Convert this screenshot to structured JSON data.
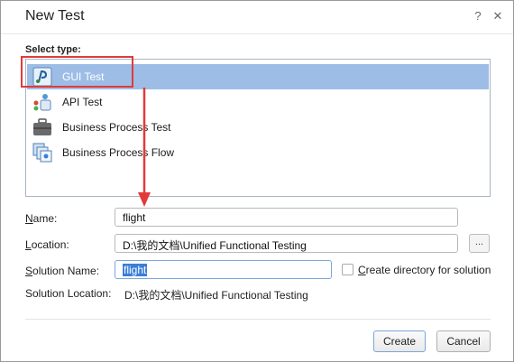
{
  "window": {
    "title": "New Test",
    "help_icon": "help-icon",
    "close_icon": "close-icon"
  },
  "select_type": {
    "label": "Select type:",
    "items": [
      {
        "label": "GUI Test",
        "icon": "gui-test-icon",
        "selected": true
      },
      {
        "label": "API Test",
        "icon": "api-test-icon",
        "selected": false
      },
      {
        "label": "Business Process Test",
        "icon": "business-process-test-icon",
        "selected": false
      },
      {
        "label": "Business Process Flow",
        "icon": "business-process-flow-icon",
        "selected": false
      }
    ]
  },
  "form": {
    "name_label": "Name:",
    "name_value": "flight",
    "location_label": "Location:",
    "location_value": "D:\\我的文档\\Unified Functional Testing",
    "browse_label": "...",
    "solution_name_label": "Solution Name:",
    "solution_name_value": "flight",
    "create_directory_label": "Create directory for solution",
    "create_directory_checked": false,
    "solution_location_label": "Solution Location:",
    "solution_location_value": "D:\\我的文档\\Unified Functional Testing"
  },
  "buttons": {
    "create": "Create",
    "cancel": "Cancel"
  },
  "annotation": {
    "highlight_color": "#e23a3a"
  }
}
